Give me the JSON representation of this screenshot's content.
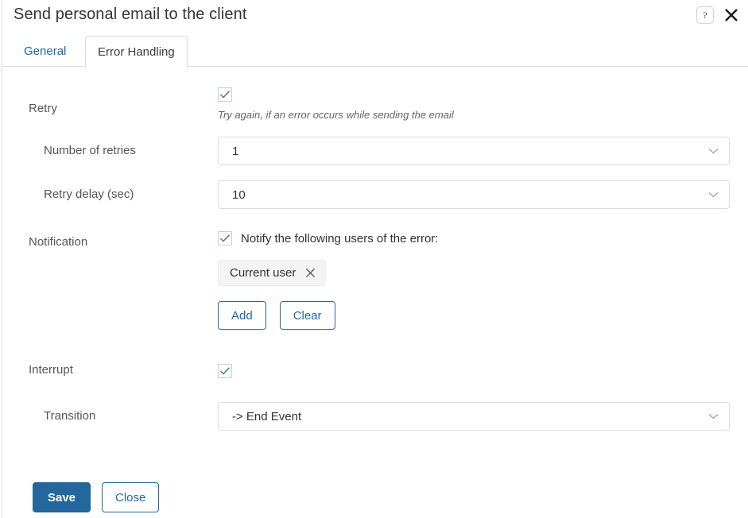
{
  "header": {
    "title": "Send personal email to the client",
    "help_icon": "question-mark-icon",
    "close_icon": "close-x-icon"
  },
  "tabs": [
    {
      "label": "General",
      "active": false
    },
    {
      "label": "Error Handling",
      "active": true
    }
  ],
  "form": {
    "retry": {
      "label": "Retry",
      "checked": true,
      "hint": "Try again, if an error occurs while sending the email"
    },
    "number_of_retries": {
      "label": "Number of retries",
      "value": "1",
      "chevron_icon": "chevron-down-icon"
    },
    "retry_delay": {
      "label": "Retry delay (sec)",
      "value": "10",
      "chevron_icon": "chevron-down-icon"
    },
    "notification": {
      "label": "Notification",
      "checked": true,
      "checkbox_text": "Notify the following users of the error:",
      "recipients": [
        {
          "label": "Current user",
          "remove_icon": "close-x-icon"
        }
      ],
      "add_label": "Add",
      "clear_label": "Clear"
    },
    "interrupt": {
      "label": "Interrupt",
      "checked": true
    },
    "transition": {
      "label": "Transition",
      "value": "-> End Event",
      "chevron_icon": "chevron-down-icon"
    }
  },
  "footer": {
    "save_label": "Save",
    "close_label": "Close"
  },
  "colors": {
    "accent_blue": "#2168a8",
    "primary_button": "#23679c",
    "label_gray": "#555555",
    "border_gray": "#dddddd",
    "chip_bg": "#f4f4f4",
    "checkmark_blue": "#3f7fbf"
  }
}
